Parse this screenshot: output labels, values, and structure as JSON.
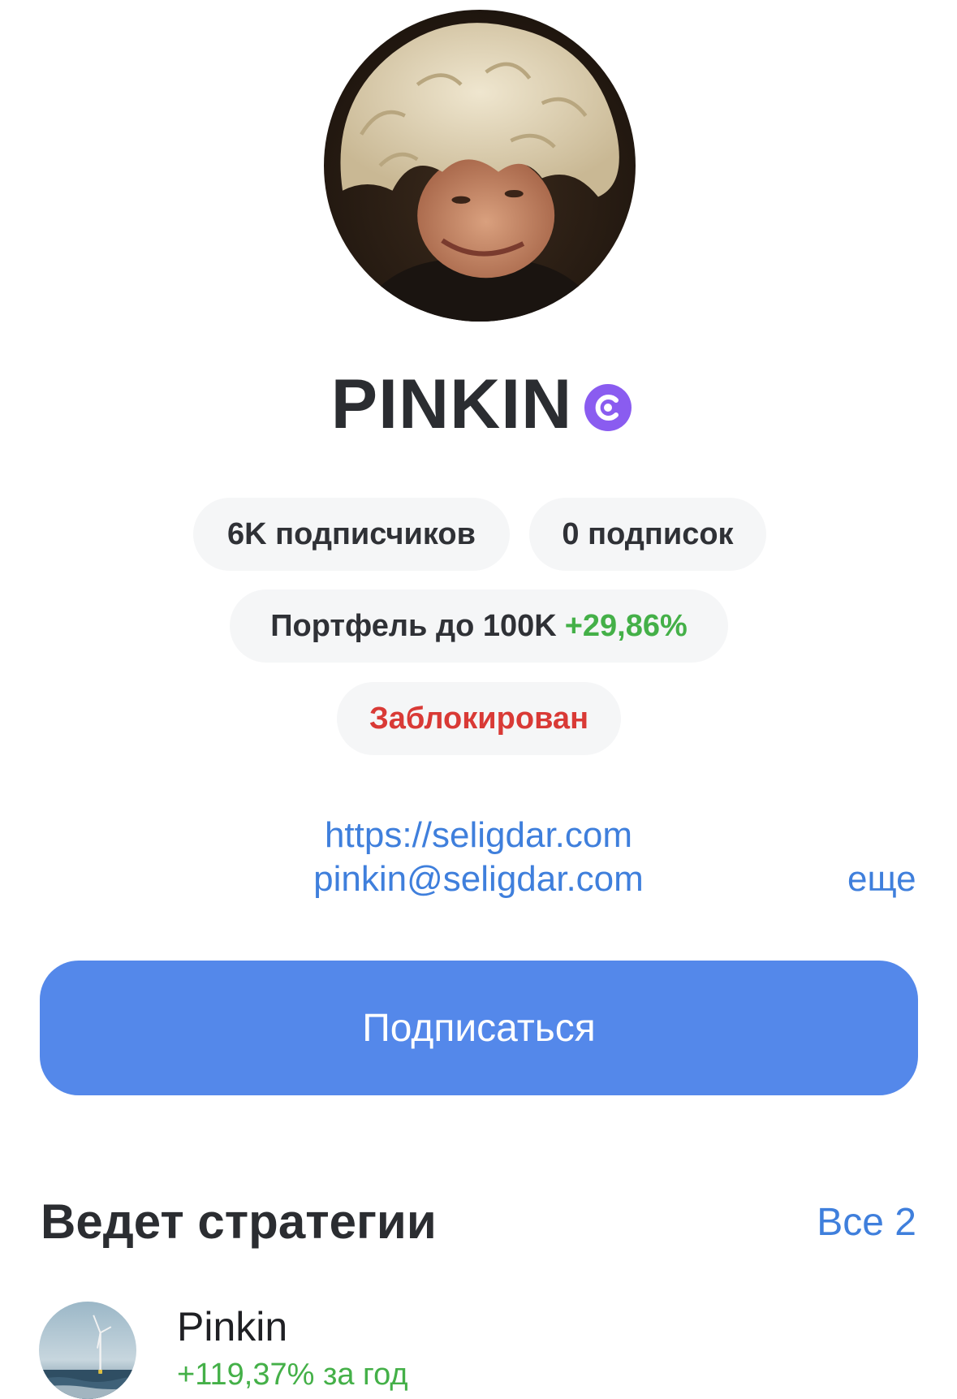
{
  "profile": {
    "name": "PINKIN",
    "verified_icon": "verified-badge-icon",
    "followers_label": "6K подписчиков",
    "following_label": "0 подписок",
    "portfolio_label": "Портфель до 100K",
    "portfolio_gain": "+29,86%",
    "blocked_label": "Заблокирован",
    "website": "https://seligdar.com",
    "email": "pinkin@seligdar.com",
    "more_label": "еще",
    "subscribe_label": "Подписаться"
  },
  "strategies": {
    "title": "Ведет стратегии",
    "all_label": "Все 2",
    "items": [
      {
        "name": "Pinkin",
        "return_label": "+119,37% за год"
      }
    ]
  },
  "colors": {
    "accent": "#5488ea",
    "link": "#3f7fdc",
    "positive": "#44b048",
    "negative": "#d93a36",
    "chip_bg": "#f5f6f7",
    "verified": "#8a5cf0"
  }
}
